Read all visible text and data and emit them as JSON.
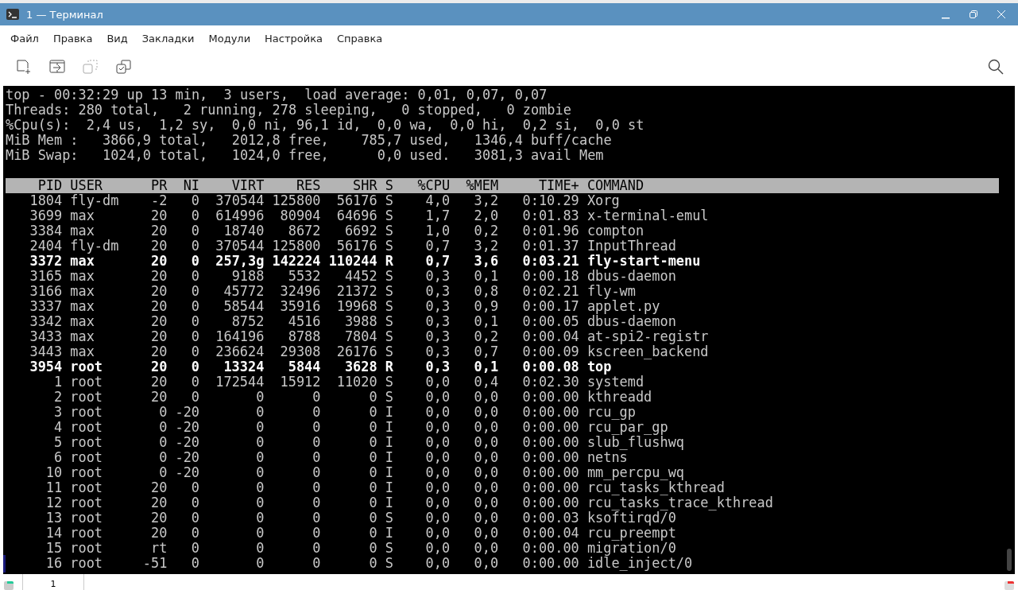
{
  "window": {
    "title": "1 — Терминал"
  },
  "menu": [
    "Файл",
    "Правка",
    "Вид",
    "Закладки",
    "Модули",
    "Настройка",
    "Справка"
  ],
  "summary": [
    "top - 00:32:29 up 13 min,  3 users,  load average: 0,01, 0,07, 0,07",
    "Threads: 280 total,   2 running, 278 sleeping,   0 stopped,   0 zombie",
    "%Cpu(s):  2,4 us,  1,2 sy,  0,0 ni, 96,1 id,  0,0 wa,  0,0 hi,  0,2 si,  0,0 st",
    "MiB Mem :   3866,9 total,   2012,8 free,    785,7 used,   1346,4 buff/cache",
    "MiB Swap:   1024,0 total,   1024,0 free,      0,0 used.   3081,3 avail Mem"
  ],
  "table": {
    "columns": [
      "PID",
      "USER",
      "PR",
      "NI",
      "VIRT",
      "RES",
      "SHR",
      "S",
      "%CPU",
      "%MEM",
      "TIME+",
      "COMMAND"
    ],
    "rows": [
      {
        "bold": false,
        "cells": [
          "1804",
          "fly-dm",
          "-2",
          "0",
          "370544",
          "125800",
          "56176",
          "S",
          "4,0",
          "3,2",
          "0:10.29",
          "Xorg"
        ]
      },
      {
        "bold": false,
        "cells": [
          "3699",
          "max",
          "20",
          "0",
          "614996",
          "80904",
          "64696",
          "S",
          "1,7",
          "2,0",
          "0:01.83",
          "x-terminal-emul"
        ]
      },
      {
        "bold": false,
        "cells": [
          "3384",
          "max",
          "20",
          "0",
          "18740",
          "8672",
          "6692",
          "S",
          "1,0",
          "0,2",
          "0:01.96",
          "compton"
        ]
      },
      {
        "bold": false,
        "cells": [
          "2404",
          "fly-dm",
          "20",
          "0",
          "370544",
          "125800",
          "56176",
          "S",
          "0,7",
          "3,2",
          "0:01.37",
          "InputThread"
        ]
      },
      {
        "bold": true,
        "cells": [
          "3372",
          "max",
          "20",
          "0",
          "257,3g",
          "142224",
          "110244",
          "R",
          "0,7",
          "3,6",
          "0:03.21",
          "fly-start-menu"
        ]
      },
      {
        "bold": false,
        "cells": [
          "3165",
          "max",
          "20",
          "0",
          "9188",
          "5532",
          "4452",
          "S",
          "0,3",
          "0,1",
          "0:00.18",
          "dbus-daemon"
        ]
      },
      {
        "bold": false,
        "cells": [
          "3166",
          "max",
          "20",
          "0",
          "45772",
          "32496",
          "21372",
          "S",
          "0,3",
          "0,8",
          "0:02.21",
          "fly-wm"
        ]
      },
      {
        "bold": false,
        "cells": [
          "3337",
          "max",
          "20",
          "0",
          "58544",
          "35916",
          "19968",
          "S",
          "0,3",
          "0,9",
          "0:00.17",
          "applet.py"
        ]
      },
      {
        "bold": false,
        "cells": [
          "3342",
          "max",
          "20",
          "0",
          "8752",
          "4516",
          "3988",
          "S",
          "0,3",
          "0,1",
          "0:00.05",
          "dbus-daemon"
        ]
      },
      {
        "bold": false,
        "cells": [
          "3433",
          "max",
          "20",
          "0",
          "164196",
          "8788",
          "7804",
          "S",
          "0,3",
          "0,2",
          "0:00.04",
          "at-spi2-registr"
        ]
      },
      {
        "bold": false,
        "cells": [
          "3443",
          "max",
          "20",
          "0",
          "236624",
          "29308",
          "26176",
          "S",
          "0,3",
          "0,7",
          "0:00.09",
          "kscreen_backend"
        ]
      },
      {
        "bold": true,
        "cells": [
          "3954",
          "root",
          "20",
          "0",
          "13324",
          "5844",
          "3628",
          "R",
          "0,3",
          "0,1",
          "0:00.08",
          "top"
        ]
      },
      {
        "bold": false,
        "cells": [
          "1",
          "root",
          "20",
          "0",
          "172544",
          "15912",
          "11020",
          "S",
          "0,0",
          "0,4",
          "0:02.30",
          "systemd"
        ]
      },
      {
        "bold": false,
        "cells": [
          "2",
          "root",
          "20",
          "0",
          "0",
          "0",
          "0",
          "S",
          "0,0",
          "0,0",
          "0:00.00",
          "kthreadd"
        ]
      },
      {
        "bold": false,
        "cells": [
          "3",
          "root",
          "0",
          "-20",
          "0",
          "0",
          "0",
          "I",
          "0,0",
          "0,0",
          "0:00.00",
          "rcu_gp"
        ]
      },
      {
        "bold": false,
        "cells": [
          "4",
          "root",
          "0",
          "-20",
          "0",
          "0",
          "0",
          "I",
          "0,0",
          "0,0",
          "0:00.00",
          "rcu_par_gp"
        ]
      },
      {
        "bold": false,
        "cells": [
          "5",
          "root",
          "0",
          "-20",
          "0",
          "0",
          "0",
          "I",
          "0,0",
          "0,0",
          "0:00.00",
          "slub_flushwq"
        ]
      },
      {
        "bold": false,
        "cells": [
          "6",
          "root",
          "0",
          "-20",
          "0",
          "0",
          "0",
          "I",
          "0,0",
          "0,0",
          "0:00.00",
          "netns"
        ]
      },
      {
        "bold": false,
        "cells": [
          "10",
          "root",
          "0",
          "-20",
          "0",
          "0",
          "0",
          "I",
          "0,0",
          "0,0",
          "0:00.00",
          "mm_percpu_wq"
        ]
      },
      {
        "bold": false,
        "cells": [
          "11",
          "root",
          "20",
          "0",
          "0",
          "0",
          "0",
          "I",
          "0,0",
          "0,0",
          "0:00.00",
          "rcu_tasks_kthread"
        ]
      },
      {
        "bold": false,
        "cells": [
          "12",
          "root",
          "20",
          "0",
          "0",
          "0",
          "0",
          "I",
          "0,0",
          "0,0",
          "0:00.00",
          "rcu_tasks_trace_kthread"
        ]
      },
      {
        "bold": false,
        "cells": [
          "13",
          "root",
          "20",
          "0",
          "0",
          "0",
          "0",
          "S",
          "0,0",
          "0,0",
          "0:00.03",
          "ksoftirqd/0"
        ]
      },
      {
        "bold": false,
        "cells": [
          "14",
          "root",
          "20",
          "0",
          "0",
          "0",
          "0",
          "I",
          "0,0",
          "0,0",
          "0:00.04",
          "rcu_preempt"
        ]
      },
      {
        "bold": false,
        "cells": [
          "15",
          "root",
          "rt",
          "0",
          "0",
          "0",
          "0",
          "S",
          "0,0",
          "0,0",
          "0:00.00",
          "migration/0"
        ]
      },
      {
        "bold": false,
        "cells": [
          "16",
          "root",
          "-51",
          "0",
          "0",
          "0",
          "0",
          "S",
          "0,0",
          "0,0",
          "0:00.00",
          "idle_inject/0"
        ]
      }
    ]
  },
  "tabs": [
    {
      "label": "1",
      "selected": true
    }
  ]
}
